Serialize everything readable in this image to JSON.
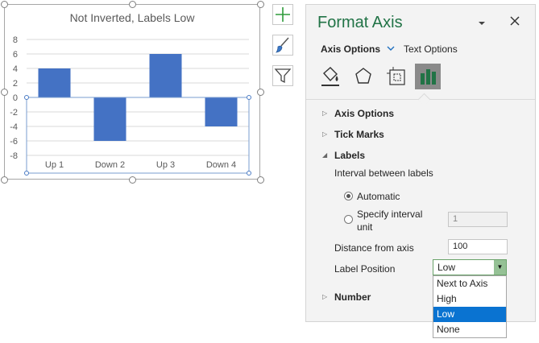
{
  "chart": {
    "title": "Not Inverted, Labels Low",
    "colors": {
      "bar": "#4472c4",
      "grid": "#d9d9d9",
      "axis": "#bfbfbf",
      "text": "#595959"
    }
  },
  "chart_data": {
    "type": "bar",
    "categories": [
      "Up 1",
      "Down 2",
      "Up 3",
      "Down 4"
    ],
    "values": [
      4,
      -6,
      6,
      -4
    ],
    "title": "Not Inverted, Labels Low",
    "xlabel": "",
    "ylabel": "",
    "ylim": [
      -8,
      8
    ],
    "yticks": [
      "8",
      "6",
      "4",
      "2",
      "0",
      "-2",
      "-4",
      "-6",
      "-8"
    ],
    "grid": true,
    "legend": "none"
  },
  "side_buttons": [
    {
      "icon": "plus-icon"
    },
    {
      "icon": "brush-icon"
    },
    {
      "icon": "filter-icon"
    }
  ],
  "pane": {
    "title": "Format Axis",
    "dropdown_icon": "chevron-down-icon",
    "close_icon": "close-icon",
    "tabs": {
      "axis_options": "Axis Options",
      "text_options": "Text Options"
    },
    "category_icons": [
      "fill-line-icon",
      "effects-icon",
      "size-properties-icon",
      "axis-options-chart-icon"
    ],
    "sections": {
      "axis_options": "Axis Options",
      "tick_marks": "Tick Marks",
      "labels": "Labels",
      "number": "Number"
    },
    "labels": {
      "interval_heading": "Interval between labels",
      "automatic": "Automatic",
      "specify_line1": "Specify interval",
      "specify_line2": "unit",
      "specify_value": "1",
      "distance_label": "Distance from axis",
      "distance_value": "100",
      "position_label": "Label Position",
      "position_value": "Low",
      "position_options": [
        "Next to Axis",
        "High",
        "Low",
        "None"
      ],
      "selected_option": "Low"
    }
  }
}
